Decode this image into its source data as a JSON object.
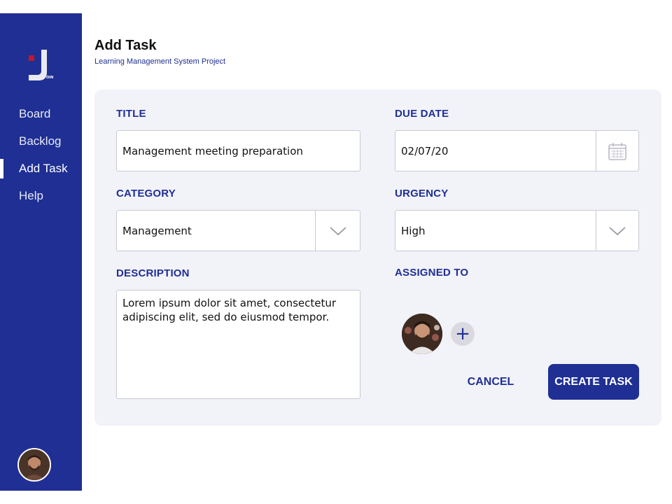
{
  "app": {
    "logo_letter": "J",
    "logo_suffix": "OIN"
  },
  "colors": {
    "primary": "#1f2f93",
    "card_bg": "#f2f2f9",
    "logo_red": "#c0182b"
  },
  "sidebar": {
    "items": [
      {
        "label": "Board",
        "active": false
      },
      {
        "label": "Backlog",
        "active": false
      },
      {
        "label": "Add Task",
        "active": true
      },
      {
        "label": "Help",
        "active": false
      }
    ],
    "user_avatar_icon": "user-avatar"
  },
  "header": {
    "title": "Add Task",
    "subtitle": "Learning Management System Project"
  },
  "form": {
    "title": {
      "label": "TITLE",
      "value": "Management meeting preparation"
    },
    "due_date": {
      "label": "DUE DATE",
      "value": "02/07/20",
      "icon": "calendar-icon"
    },
    "category": {
      "label": "CATEGORY",
      "value": "Management",
      "icon": "chevron-down-icon"
    },
    "urgency": {
      "label": "URGENCY",
      "value": "High",
      "icon": "chevron-down-icon"
    },
    "description": {
      "label": "DESCRIPTION",
      "value": "Lorem ipsum dolor sit amet, consectetur adipiscing elit, sed do eiusmod tempor."
    },
    "assigned_to": {
      "label": "ASSIGNED TO",
      "add_icon": "plus-icon",
      "add_symbol": "+"
    }
  },
  "actions": {
    "cancel_label": "CANCEL",
    "create_label": "CREATE TASK"
  }
}
